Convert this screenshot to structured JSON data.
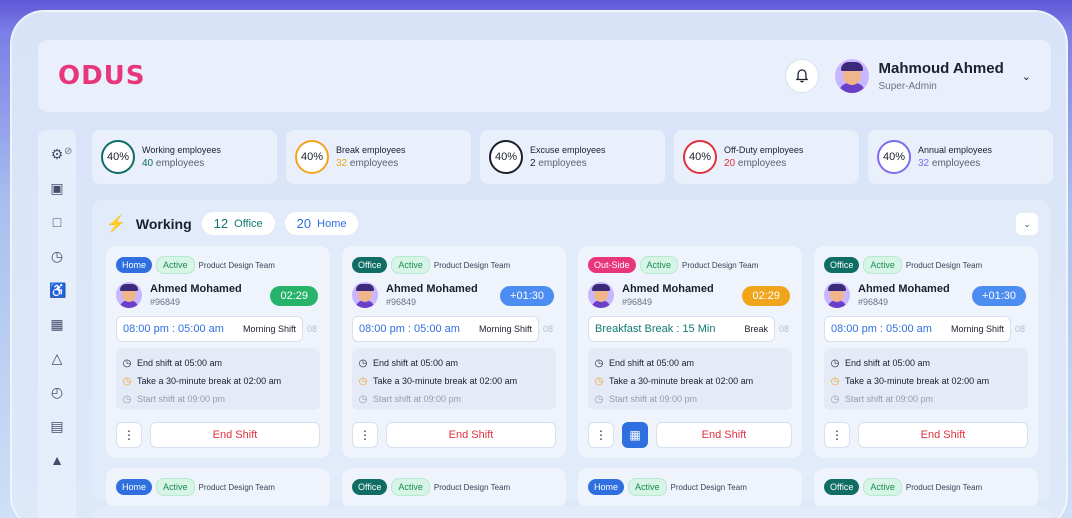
{
  "brand": {
    "logo_text": "ODUS",
    "accent": "#e8367a"
  },
  "user": {
    "name": "Mahmoud Ahmed",
    "role": "Super-Admin"
  },
  "stats": [
    {
      "percent": "40%",
      "label": "Working employees",
      "count": "40",
      "unit": "employees",
      "color": "#0f6d66"
    },
    {
      "percent": "40%",
      "label": "Break employees",
      "count": "32",
      "unit": "employees",
      "color": "#f0a51d"
    },
    {
      "percent": "40%",
      "label": "Excuse employees",
      "count": "2",
      "unit": "employees",
      "color": "#1b1f2e"
    },
    {
      "percent": "40%",
      "label": "Off-Duty employees",
      "count": "20",
      "unit": "employees",
      "color": "#e0313f"
    },
    {
      "percent": "40%",
      "label": "Annual employees",
      "count": "32",
      "unit": "employees",
      "color": "#7b6cf0"
    }
  ],
  "panel": {
    "title": "Working",
    "office_count": "12",
    "office_label": "Office",
    "home_count": "20",
    "home_label": "Home"
  },
  "cards": [
    {
      "location": "Home",
      "status": "Active",
      "team": "Product Design Team",
      "name": "Ahmed Mohamed",
      "id": "#96849",
      "timer": "02:29",
      "shift_time": "08:00 pm : 05:00 am",
      "shift_name": "Morning Shift",
      "shift_more": "08",
      "events": [
        "End shift at 05:00 am",
        "Take a 30-minute break at 02:00 am",
        "Start shift at 09:00 pm"
      ],
      "end_label": "End Shift"
    },
    {
      "location": "Office",
      "status": "Active",
      "team": "Product Design Team",
      "name": "Ahmed Mohamed",
      "id": "#96849",
      "timer": "+01:30",
      "shift_time": "08:00 pm : 05:00 am",
      "shift_name": "Morning Shift",
      "shift_more": "08",
      "events": [
        "End shift at 05:00 am",
        "Take a 30-minute break at 02:00 am",
        "Start shift at 09:00 pm"
      ],
      "end_label": "End Shift"
    },
    {
      "location": "Out-Side",
      "status": "Active",
      "team": "Product Design Team",
      "name": "Ahmed Mohamed",
      "id": "#96849",
      "timer": "02:29",
      "shift_time": "Breakfast Break : 15 Min",
      "shift_name": "Break",
      "shift_more": "08",
      "events": [
        "End shift at 05:00 am",
        "Take a 30-minute break at 02:00 am",
        "Start shift at 09:00 pm"
      ],
      "end_label": "End Shift"
    },
    {
      "location": "Office",
      "status": "Active",
      "team": "Product Design Team",
      "name": "Ahmed Mohamed",
      "id": "#96849",
      "timer": "+01:30",
      "shift_time": "08:00 pm : 05:00 am",
      "shift_name": "Morning Shift",
      "shift_more": "08",
      "events": [
        "End shift at 05:00 am",
        "Take a 30-minute break at 02:00 am",
        "Start shift at 09:00 pm"
      ],
      "end_label": "End Shift"
    }
  ],
  "cards_row2": [
    {
      "location": "Home",
      "status": "Active",
      "team": "Product Design Team"
    },
    {
      "location": "Office",
      "status": "Active",
      "team": "Product Design Team"
    },
    {
      "location": "Home",
      "status": "Active",
      "team": "Product Design Team"
    },
    {
      "location": "Office",
      "status": "Active",
      "team": "Product Design Team"
    }
  ]
}
